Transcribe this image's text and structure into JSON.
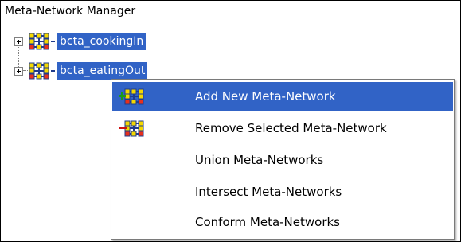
{
  "panel": {
    "title": "Meta-Network Manager"
  },
  "tree": {
    "items": [
      {
        "label": "bcta_cookingIn",
        "icon": "meta-network-icon",
        "expander": "expand-plus-icon"
      },
      {
        "label": "bcta_eatingOut",
        "icon": "meta-network-icon",
        "expander": "expand-plus-icon"
      }
    ]
  },
  "context_menu": {
    "items": [
      {
        "label": "Add New Meta-Network",
        "icon": "add-meta-network-icon",
        "selected": true
      },
      {
        "label": "Remove Selected Meta-Network",
        "icon": "remove-meta-network-icon",
        "selected": false
      },
      {
        "label": "Union Meta-Networks",
        "icon": "",
        "selected": false
      },
      {
        "label": "Intersect Meta-Networks",
        "icon": "",
        "selected": false
      },
      {
        "label": "Conform Meta-Networks",
        "icon": "",
        "selected": false
      }
    ]
  },
  "colors": {
    "selection": "#3163c6",
    "node_fill": "#f5d800",
    "node_red": "#e8301c",
    "edge_blue": "#1f3b8c"
  }
}
